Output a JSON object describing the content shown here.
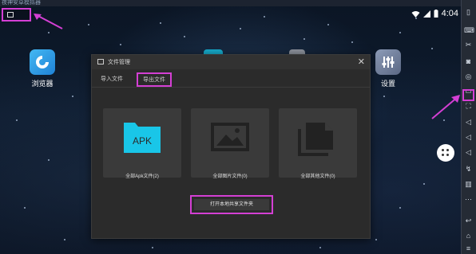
{
  "window": {
    "title": "夜神安卓模拟器"
  },
  "status_bar": {
    "time": "4:04",
    "wifi_icon": "wifi-icon",
    "signal_icon": "signal-icon",
    "battery_icon": "battery-icon"
  },
  "desktop": {
    "icons": [
      {
        "label": "浏览器",
        "icon": "browser-icon"
      },
      {
        "label": "设置",
        "icon": "settings-icon"
      }
    ]
  },
  "dialog": {
    "title": "文件管理",
    "close": "✕",
    "tabs": [
      {
        "label": "导入文件",
        "active": false
      },
      {
        "label": "导出文件",
        "active": true
      }
    ],
    "cards": [
      {
        "label": "全部Apk文件(2)",
        "icon": "apk-folder-icon",
        "badge": "APK"
      },
      {
        "label": "全部图片文件(0)",
        "icon": "image-icon"
      },
      {
        "label": "全部其他文件(0)",
        "icon": "file-stack-icon"
      }
    ],
    "open_button": "打开本地共享文件夹"
  },
  "sidebar": {
    "icons": [
      "phone-icon",
      "keyboard-icon",
      "scissors-icon",
      "camera-icon",
      "location-icon",
      "screen-record-icon",
      "fullscreen-icon",
      "volume-up-icon",
      "volume-down-icon",
      "volume-mute-icon",
      "shake-icon",
      "trash-icon",
      "more-icon",
      "back-icon",
      "home-icon",
      "menu-icon"
    ]
  },
  "colors": {
    "highlight": "#d43fd4",
    "accent_apk": "#19c6e8"
  }
}
